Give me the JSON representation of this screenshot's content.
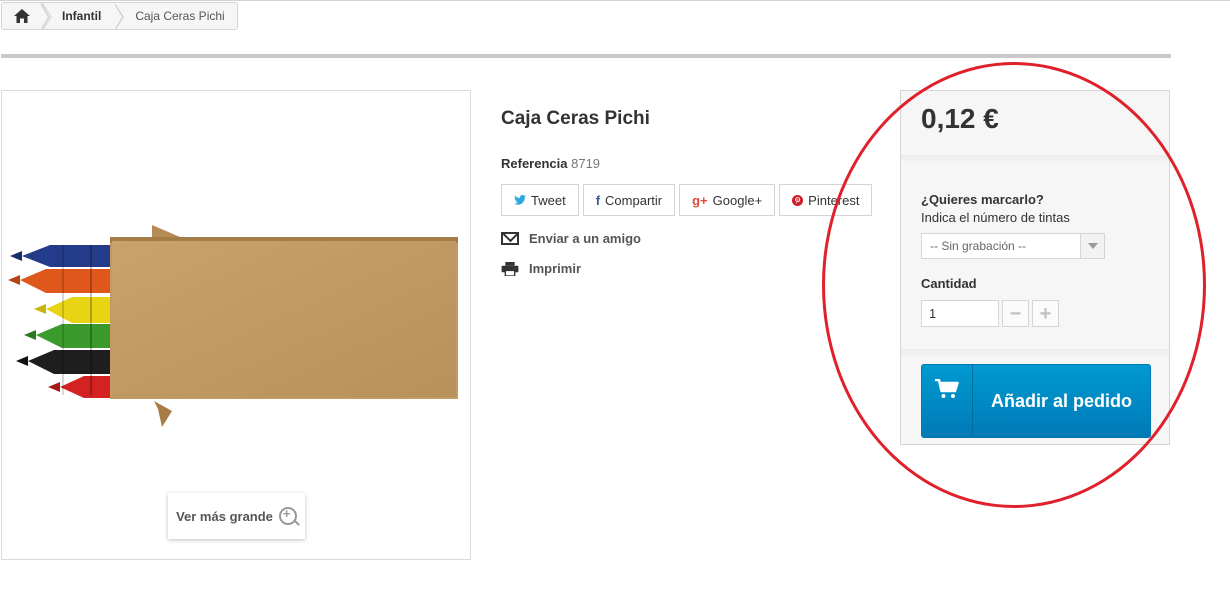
{
  "breadcrumb": {
    "home_icon": "home-icon",
    "category": "Infantil",
    "current": "Caja Ceras Pichi"
  },
  "product": {
    "title": "Caja Ceras Pichi",
    "reference_label": "Referencia",
    "reference_value": "8719",
    "zoom_label": "Ver más grande",
    "image_alt": "Caja de ceras de colores"
  },
  "social": [
    {
      "icon": "twitter-icon",
      "label": "Tweet"
    },
    {
      "icon": "facebook-icon",
      "label": "Compartir"
    },
    {
      "icon": "google-plus-icon",
      "label": "Google+"
    },
    {
      "icon": "pinterest-icon",
      "label": "Pinterest"
    }
  ],
  "actions": {
    "send_friend": "Enviar a un amigo",
    "print": "Imprimir"
  },
  "buy_box": {
    "price": "0,12 €",
    "mark_question": "¿Quieres marcarlo?",
    "mark_hint": "Indica el número de tintas",
    "ink_select_value": "-- Sin grabación --",
    "quantity_label": "Cantidad",
    "quantity_value": "1",
    "minus": "−",
    "plus": "+",
    "add_to_cart": "Añadir al pedido"
  },
  "colors": {
    "accent_blue": "#009ad0",
    "annotation_red": "#e0202a"
  }
}
